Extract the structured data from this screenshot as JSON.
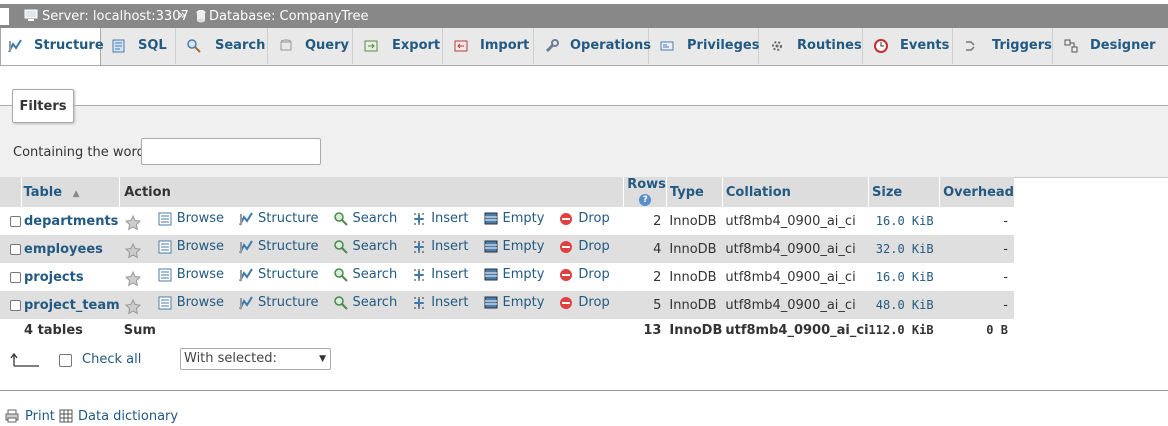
{
  "breadcrumb": {
    "server_label": "Server: localhost:3307",
    "separator": "»",
    "database_label": "Database: CompanyTree"
  },
  "tabs": [
    {
      "label": "Structure",
      "icon": "structure-icon",
      "active": true
    },
    {
      "label": "SQL",
      "icon": "sql-icon"
    },
    {
      "label": "Search",
      "icon": "search-icon"
    },
    {
      "label": "Query",
      "icon": "query-icon"
    },
    {
      "label": "Export",
      "icon": "export-icon"
    },
    {
      "label": "Import",
      "icon": "import-icon"
    },
    {
      "label": "Operations",
      "icon": "wrench-icon"
    },
    {
      "label": "Privileges",
      "icon": "privileges-icon"
    },
    {
      "label": "Routines",
      "icon": "routines-icon"
    },
    {
      "label": "Events",
      "icon": "clock-icon"
    },
    {
      "label": "Triggers",
      "icon": "triggers-icon"
    },
    {
      "label": "Designer",
      "icon": "designer-icon"
    }
  ],
  "filters": {
    "legend": "Filters",
    "label": "Containing the word:",
    "value": ""
  },
  "table": {
    "headers": {
      "table": "Table",
      "action": "Action",
      "rows": "Rows",
      "type": "Type",
      "collation": "Collation",
      "size": "Size",
      "overhead": "Overhead"
    },
    "actions": {
      "browse": "Browse",
      "structure": "Structure",
      "search": "Search",
      "insert": "Insert",
      "empty": "Empty",
      "drop": "Drop"
    },
    "rows": [
      {
        "name": "departments",
        "rows": "2",
        "type": "InnoDB",
        "collation": "utf8mb4_0900_ai_ci",
        "size": "16.0 KiB",
        "overhead": "-"
      },
      {
        "name": "employees",
        "rows": "4",
        "type": "InnoDB",
        "collation": "utf8mb4_0900_ai_ci",
        "size": "32.0 KiB",
        "overhead": "-"
      },
      {
        "name": "projects",
        "rows": "2",
        "type": "InnoDB",
        "collation": "utf8mb4_0900_ai_ci",
        "size": "16.0 KiB",
        "overhead": "-"
      },
      {
        "name": "project_team",
        "rows": "5",
        "type": "InnoDB",
        "collation": "utf8mb4_0900_ai_ci",
        "size": "48.0 KiB",
        "overhead": "-"
      }
    ],
    "footer": {
      "count": "4 tables",
      "sum": "Sum",
      "rows": "13",
      "type": "InnoDB",
      "collation": "utf8mb4_0900_ai_ci",
      "size": "112.0 KiB",
      "overhead": "0 B"
    }
  },
  "bulk": {
    "check_all": "Check all",
    "with_selected": "With selected:"
  },
  "links": {
    "print": "Print",
    "data_dictionary": "Data dictionary"
  }
}
